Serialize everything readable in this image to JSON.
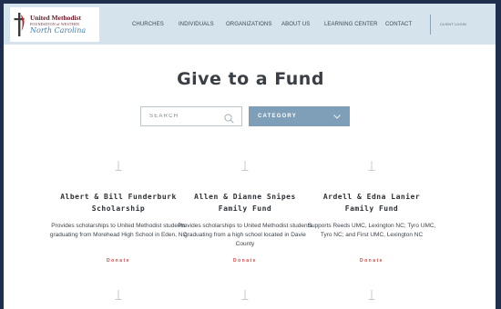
{
  "header": {
    "logo": {
      "line1": "United Methodist",
      "line2": "FOUNDATION of WESTERN",
      "line3": "North Carolina"
    },
    "nav": [
      {
        "label": "CHURCHES"
      },
      {
        "label": "INDIVIDUALS"
      },
      {
        "label": "ORGANIZATIONS"
      },
      {
        "label": "ABOUT US"
      },
      {
        "label": "LEARNING CENTER"
      },
      {
        "label": "CONTACT"
      }
    ],
    "login_label": "CLIENT LOGIN"
  },
  "page": {
    "title": "Give to a Fund"
  },
  "filters": {
    "search_placeholder": "SEARCH",
    "category_label": "CATEGORY"
  },
  "funds": [
    {
      "title_line1": "Albert & Bill Funderburk",
      "title_line2": "Scholarship",
      "description": "Provides scholarships to United Methodist students graduating from Morehead High School in Eden, NC",
      "donate_label": "Donate"
    },
    {
      "title_line1": "Allen & Dianne Snipes",
      "title_line2": "Family Fund",
      "description": "Provides scholarships to United Methodist students graduating from a high school located in Davie County",
      "donate_label": "Donate"
    },
    {
      "title_line1": "Ardell & Edna Lanier",
      "title_line2": "Family Fund",
      "description": "Supports Reeds UMC, Lexington NC; Tyro UMC, Tyro NC; and First UMC, Lexington NC",
      "donate_label": "Donate"
    }
  ],
  "colors": {
    "frame": "#1f2f4d",
    "header_bg": "#d4e3ec",
    "category_bg": "#7e9fb7",
    "donate": "#d04848",
    "logo_maroon": "#6a1b2a"
  }
}
